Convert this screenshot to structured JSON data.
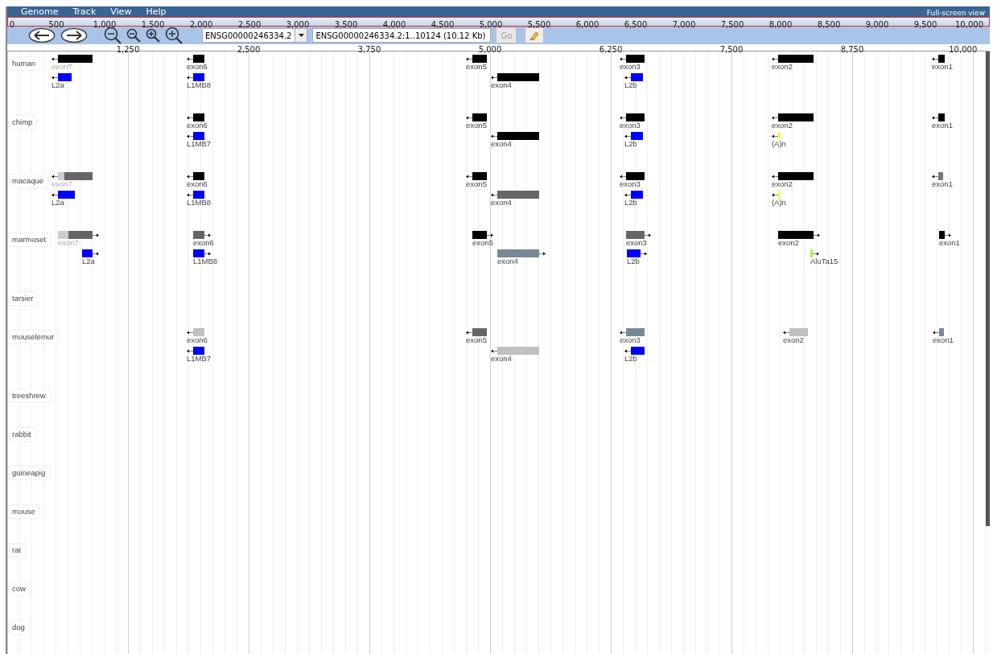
{
  "menu": {
    "items": [
      "Genome",
      "Track",
      "View",
      "Help"
    ],
    "fullscreen": "Full-screen view"
  },
  "overview_ruler": {
    "ticks": [
      "0",
      "500",
      "1,000",
      "1,500",
      "2,000",
      "2,500",
      "3,000",
      "3,500",
      "4,000",
      "4,500",
      "5,000",
      "5,500",
      "6,000",
      "6,500",
      "7,000",
      "7,500",
      "8,000",
      "8,500",
      "9,000",
      "9,500",
      "10,000"
    ]
  },
  "toolbar": {
    "reference": "ENSG00000246334.2",
    "location": "ENSG00000246334.2:1..10124 (10.12 Kb)",
    "go": {
      "label": "Go",
      "disabled": true
    }
  },
  "detail_ruler": {
    "ticks": [
      "1,250",
      "2,500",
      "3,750",
      "5,000",
      "6,250",
      "7,500",
      "8,750",
      "10,000"
    ]
  },
  "tracks": [
    {
      "name": "human",
      "lines": [
        [
          {
            "label": "exon7",
            "reverse_strand": true,
            "faded_label": true,
            "blocks": [
              {
                "color": "#000000"
              }
            ]
          },
          {
            "label": "exon6",
            "reverse_strand": true,
            "faded_label": false,
            "blocks": [
              {
                "color": "#000000"
              }
            ]
          },
          {
            "label": "exon5",
            "reverse_strand": true,
            "faded_label": false,
            "blocks": [
              {
                "color": "#000000"
              }
            ]
          },
          {
            "label": "exon3",
            "reverse_strand": true,
            "faded_label": false,
            "blocks": [
              {
                "color": "#000000"
              }
            ]
          },
          {
            "label": "exon2",
            "reverse_strand": true,
            "faded_label": false,
            "blocks": [
              {
                "color": "#000000"
              }
            ]
          },
          {
            "label": "exon1",
            "reverse_strand": true,
            "faded_label": false,
            "blocks": [
              {
                "color": "#000000"
              }
            ]
          }
        ],
        [
          {
            "label": "L2a",
            "reverse_strand": true,
            "faded_label": false,
            "blocks": [
              {
                "color": "#0000ff"
              }
            ]
          },
          {
            "label": "L1MB8",
            "reverse_strand": true,
            "faded_label": false,
            "blocks": [
              {
                "color": "#0000ff"
              }
            ]
          },
          {
            "label": "exon4",
            "reverse_strand": true,
            "faded_label": false,
            "blocks": [
              {
                "color": "#000000"
              }
            ]
          },
          {
            "label": "L2b",
            "reverse_strand": true,
            "faded_label": false,
            "blocks": [
              {
                "color": "#0000ff"
              }
            ]
          }
        ]
      ]
    },
    {
      "name": "chimp",
      "lines": [
        [
          {
            "label": "exon6",
            "reverse_strand": true,
            "faded_label": false,
            "blocks": [
              {
                "color": "#000000"
              }
            ]
          },
          {
            "label": "exon5",
            "reverse_strand": true,
            "faded_label": false,
            "blocks": [
              {
                "color": "#000000"
              }
            ]
          },
          {
            "label": "exon3",
            "reverse_strand": true,
            "faded_label": false,
            "blocks": [
              {
                "color": "#000000"
              }
            ]
          },
          {
            "label": "exon2",
            "reverse_strand": true,
            "faded_label": false,
            "blocks": [
              {
                "color": "#000000"
              }
            ]
          },
          {
            "label": "exon1",
            "reverse_strand": true,
            "faded_label": false,
            "blocks": [
              {
                "color": "#000000"
              }
            ]
          }
        ],
        [
          {
            "label": "L1MB7",
            "reverse_strand": true,
            "faded_label": false,
            "blocks": [
              {
                "color": "#0000ff"
              }
            ]
          },
          {
            "label": "exon4",
            "reverse_strand": true,
            "faded_label": false,
            "blocks": [
              {
                "color": "#000000"
              }
            ]
          },
          {
            "label": "L2b",
            "reverse_strand": true,
            "faded_label": false,
            "blocks": [
              {
                "color": "#0000ff"
              }
            ]
          },
          {
            "label": "(A)n",
            "reverse_strand": true,
            "faded_label": false,
            "blocks": [
              {
                "color": "#ffff00"
              }
            ]
          }
        ]
      ]
    },
    {
      "name": "macaque",
      "lines": [
        [
          {
            "label": "exon7",
            "reverse_strand": true,
            "faded_label": true,
            "blocks": [
              {
                "color": "#cccccc"
              },
              {
                "color": "#666666"
              }
            ]
          },
          {
            "label": "exon6",
            "reverse_strand": true,
            "faded_label": false,
            "blocks": [
              {
                "color": "#000000"
              }
            ]
          },
          {
            "label": "exon5",
            "reverse_strand": true,
            "faded_label": false,
            "blocks": [
              {
                "color": "#000000"
              }
            ]
          },
          {
            "label": "exon3",
            "reverse_strand": true,
            "faded_label": false,
            "blocks": [
              {
                "color": "#000000"
              }
            ]
          },
          {
            "label": "exon2",
            "reverse_strand": true,
            "faded_label": false,
            "blocks": [
              {
                "color": "#000000"
              }
            ]
          },
          {
            "label": "exon1",
            "reverse_strand": true,
            "faded_label": false,
            "blocks": [
              {
                "color": "#777777"
              }
            ]
          }
        ],
        [
          {
            "label": "L2a",
            "reverse_strand": true,
            "faded_label": false,
            "blocks": [
              {
                "color": "#0000ff"
              }
            ]
          },
          {
            "label": "L1MB8",
            "reverse_strand": true,
            "faded_label": false,
            "blocks": [
              {
                "color": "#0000ff"
              }
            ]
          },
          {
            "label": "exon4",
            "reverse_strand": true,
            "faded_label": false,
            "blocks": [
              {
                "color": "#666666"
              }
            ]
          },
          {
            "label": "L2b",
            "reverse_strand": true,
            "faded_label": false,
            "blocks": [
              {
                "color": "#0000ff"
              }
            ]
          },
          {
            "label": "(A)n",
            "reverse_strand": true,
            "faded_label": false,
            "blocks": [
              {
                "color": "#ffff00"
              }
            ]
          }
        ]
      ]
    },
    {
      "name": "marmoset",
      "lines": [
        [
          {
            "label": "exon7",
            "reverse_strand": false,
            "faded_label": true,
            "blocks": [
              {
                "color": "#cccccc"
              },
              {
                "color": "#666666"
              }
            ]
          },
          {
            "label": "exon6",
            "reverse_strand": false,
            "faded_label": false,
            "blocks": [
              {
                "color": "#666666"
              }
            ]
          },
          {
            "label": "exon5",
            "reverse_strand": false,
            "faded_label": false,
            "blocks": [
              {
                "color": "#000000"
              }
            ]
          },
          {
            "label": "exon3",
            "reverse_strand": false,
            "faded_label": false,
            "blocks": [
              {
                "color": "#666666"
              }
            ]
          },
          {
            "label": "exon2",
            "reverse_strand": false,
            "faded_label": false,
            "blocks": [
              {
                "color": "#000000"
              }
            ]
          },
          {
            "label": "exon1",
            "reverse_strand": false,
            "faded_label": false,
            "blocks": [
              {
                "color": "#000000"
              }
            ]
          }
        ],
        [
          {
            "label": "L2a",
            "reverse_strand": false,
            "faded_label": false,
            "blocks": [
              {
                "color": "#0000ff"
              }
            ]
          },
          {
            "label": "L1MB8",
            "reverse_strand": false,
            "faded_label": false,
            "blocks": [
              {
                "color": "#0000ff"
              }
            ]
          },
          {
            "label": "exon4",
            "reverse_strand": false,
            "faded_label": false,
            "blocks": [
              {
                "color": "#778899"
              }
            ]
          },
          {
            "label": "L2b",
            "reverse_strand": false,
            "faded_label": false,
            "blocks": [
              {
                "color": "#0000ff"
              }
            ]
          },
          {
            "label": "AluTa15",
            "reverse_strand": false,
            "faded_label": false,
            "blocks": [
              {
                "color": "#99ff33"
              }
            ]
          }
        ]
      ]
    },
    {
      "name": "tarsier"
    },
    {
      "name": "mouselemur",
      "lines": [
        [
          {
            "label": "exon6",
            "reverse_strand": true,
            "faded_label": false,
            "blocks": [
              {
                "color": "#c0c0c0"
              }
            ]
          },
          {
            "label": "exon5",
            "reverse_strand": true,
            "faded_label": false,
            "blocks": [
              {
                "color": "#666666"
              }
            ]
          },
          {
            "label": "exon3",
            "reverse_strand": true,
            "faded_label": false,
            "blocks": [
              {
                "color": "#778899"
              }
            ]
          },
          {
            "label": "exon2",
            "reverse_strand": true,
            "faded_label": false,
            "blocks": [
              {
                "color": "#c0c0c0"
              }
            ]
          },
          {
            "label": "exon1",
            "reverse_strand": true,
            "faded_label": false,
            "blocks": [
              {
                "color": "#778899"
              }
            ]
          }
        ],
        [
          {
            "label": "L1MB7",
            "reverse_strand": true,
            "faded_label": false,
            "blocks": [
              {
                "color": "#0000ff"
              }
            ]
          },
          {
            "label": "exon4",
            "reverse_strand": true,
            "faded_label": false,
            "blocks": [
              {
                "color": "#c0c0c0"
              }
            ]
          },
          {
            "label": "L2b",
            "reverse_strand": true,
            "faded_label": false,
            "blocks": [
              {
                "color": "#0000ff"
              }
            ]
          }
        ]
      ]
    },
    {
      "name": "treeshrew"
    },
    {
      "name": "rabbit"
    },
    {
      "name": "guineapig"
    },
    {
      "name": "mouse"
    },
    {
      "name": "rat"
    },
    {
      "name": "cow"
    },
    {
      "name": "dog"
    }
  ]
}
